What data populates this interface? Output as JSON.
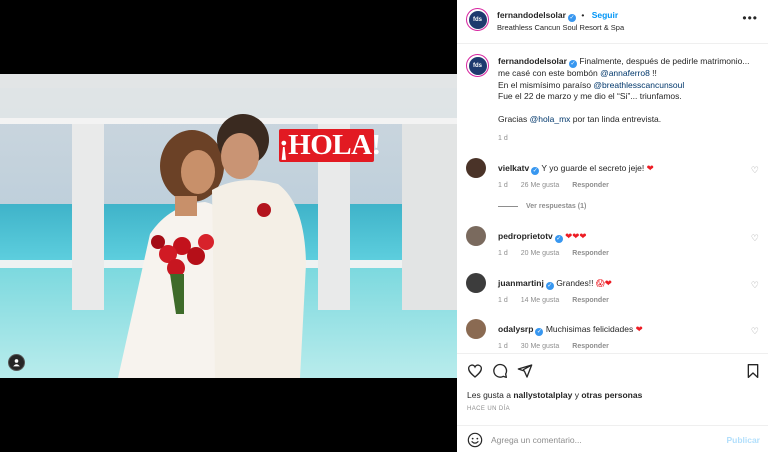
{
  "post": {
    "username": "fernandodelsolar",
    "follow_label": "Seguir",
    "separator": "•",
    "location": "Breathless Cancun Soul Resort & Spa",
    "more_icon": "more-horizontal-icon",
    "media_badge": "¡HOLA!"
  },
  "caption": {
    "username": "fernandodelsolar",
    "line1_pre": "Finalmente, después de pedirle matrimonio... me casé con este bombón ",
    "line1_mention": "@annaferro8",
    "line1_post": " !!",
    "line2_pre": "En el mismísimo paraíso ",
    "line2_mention": "@breathlesscancunsoul",
    "line3": "Fue el 22 de marzo y me dio el “Si”... triunfamos.",
    "line4_pre": "Gracias ",
    "line4_mention": "@hola_mx",
    "line4_post": " por tan linda entrevista.",
    "time": "1 d"
  },
  "comments": [
    {
      "username": "vielkatv",
      "text": "Y yo guarde el secreto jeje! ",
      "emoji": "❤",
      "time": "1 d",
      "likes": "26 Me gusta",
      "reply": "Responder"
    },
    {
      "username": "pedroprietotv",
      "text": "",
      "emoji": "❤❤❤",
      "time": "1 d",
      "likes": "20 Me gusta",
      "reply": "Responder"
    },
    {
      "username": "juanmartinj",
      "text": "Grandes!! ",
      "emoji": "😱❤",
      "time": "1 d",
      "likes": "14 Me gusta",
      "reply": "Responder"
    },
    {
      "username": "odalysrp",
      "text": "Muchisimas felicidades ",
      "emoji": "❤",
      "time": "1 d",
      "likes": "30 Me gusta",
      "reply": "Responder"
    }
  ],
  "view_replies": "Ver respuestas (1)",
  "actions": {
    "like_icon": "heart-icon",
    "comment_icon": "comment-icon",
    "share_icon": "share-icon",
    "save_icon": "bookmark-icon"
  },
  "likes": {
    "prefix": "Les gusta a ",
    "user": "nallystotalplay",
    "middle": " y ",
    "others": "otras personas"
  },
  "posted_ago": "HACE UN DÍA",
  "composer": {
    "placeholder": "Agrega un comentario...",
    "publish_label": "Publicar",
    "emoji_icon": "smiley-icon"
  },
  "colors": {
    "link": "#0095f6",
    "mention": "#00376b",
    "badge_red": "#e21a22",
    "verified": "#3897f0",
    "muted": "#8e8e8e"
  }
}
